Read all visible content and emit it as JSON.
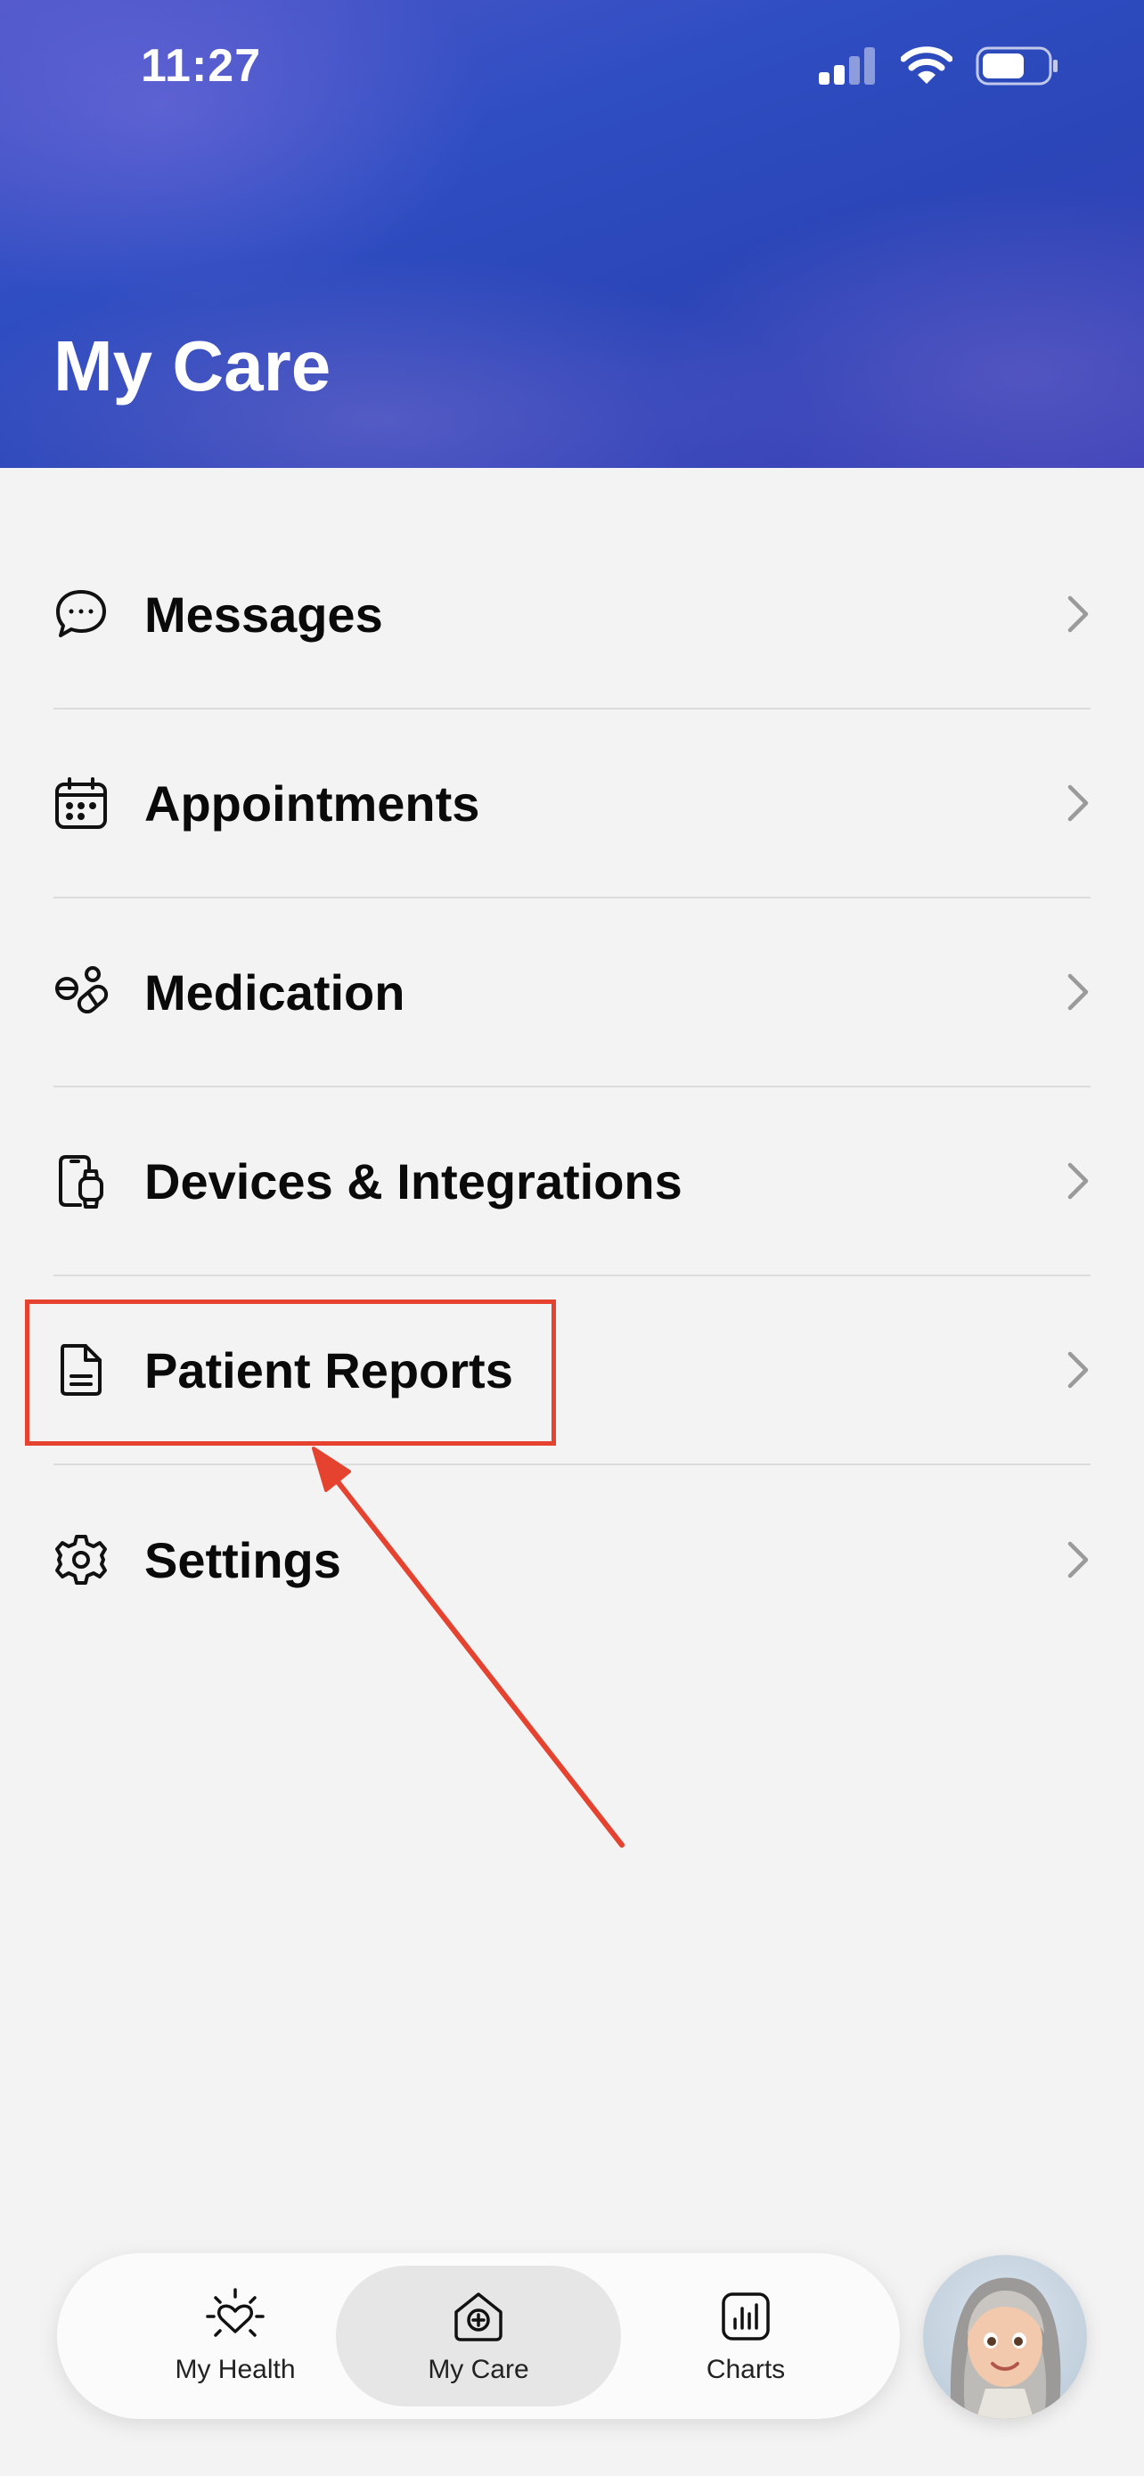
{
  "status_bar": {
    "time": "11:27"
  },
  "header": {
    "title": "My Care"
  },
  "menu": {
    "items": [
      {
        "label": "Messages",
        "icon": "chat-bubble-icon"
      },
      {
        "label": "Appointments",
        "icon": "calendar-icon"
      },
      {
        "label": "Medication",
        "icon": "pills-icon"
      },
      {
        "label": "Devices & Integrations",
        "icon": "phone-watch-icon"
      },
      {
        "label": "Patient Reports",
        "icon": "document-icon"
      },
      {
        "label": "Settings",
        "icon": "gear-icon"
      }
    ]
  },
  "annotation": {
    "highlight_color": "#e5432f",
    "highlighted_item": "Patient Reports"
  },
  "tabbar": {
    "tabs": [
      {
        "label": "My Health",
        "icon": "heart-sun-icon"
      },
      {
        "label": "My Care",
        "icon": "house-plus-icon",
        "active": true
      },
      {
        "label": "Charts",
        "icon": "bar-chart-icon"
      }
    ]
  },
  "colors": {
    "header_primary": "#2f4ec2",
    "background": "#f3f3f3",
    "text": "#0a0a0a"
  }
}
